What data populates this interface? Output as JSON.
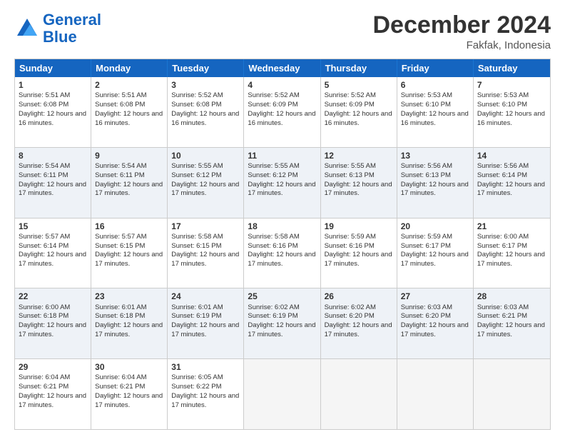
{
  "logo": {
    "line1": "General",
    "line2": "Blue"
  },
  "title": "December 2024",
  "location": "Fakfak, Indonesia",
  "weekdays": [
    "Sunday",
    "Monday",
    "Tuesday",
    "Wednesday",
    "Thursday",
    "Friday",
    "Saturday"
  ],
  "rows": [
    [
      null,
      {
        "day": 2,
        "sunrise": "5:51 AM",
        "sunset": "6:08 PM",
        "daylight": "12 hours and 16 minutes."
      },
      {
        "day": 3,
        "sunrise": "5:52 AM",
        "sunset": "6:08 PM",
        "daylight": "12 hours and 16 minutes."
      },
      {
        "day": 4,
        "sunrise": "5:52 AM",
        "sunset": "6:09 PM",
        "daylight": "12 hours and 16 minutes."
      },
      {
        "day": 5,
        "sunrise": "5:52 AM",
        "sunset": "6:09 PM",
        "daylight": "12 hours and 16 minutes."
      },
      {
        "day": 6,
        "sunrise": "5:53 AM",
        "sunset": "6:10 PM",
        "daylight": "12 hours and 16 minutes."
      },
      {
        "day": 7,
        "sunrise": "5:53 AM",
        "sunset": "6:10 PM",
        "daylight": "12 hours and 16 minutes."
      }
    ],
    [
      {
        "day": 8,
        "sunrise": "5:54 AM",
        "sunset": "6:11 PM",
        "daylight": "12 hours and 17 minutes."
      },
      {
        "day": 9,
        "sunrise": "5:54 AM",
        "sunset": "6:11 PM",
        "daylight": "12 hours and 17 minutes."
      },
      {
        "day": 10,
        "sunrise": "5:55 AM",
        "sunset": "6:12 PM",
        "daylight": "12 hours and 17 minutes."
      },
      {
        "day": 11,
        "sunrise": "5:55 AM",
        "sunset": "6:12 PM",
        "daylight": "12 hours and 17 minutes."
      },
      {
        "day": 12,
        "sunrise": "5:55 AM",
        "sunset": "6:13 PM",
        "daylight": "12 hours and 17 minutes."
      },
      {
        "day": 13,
        "sunrise": "5:56 AM",
        "sunset": "6:13 PM",
        "daylight": "12 hours and 17 minutes."
      },
      {
        "day": 14,
        "sunrise": "5:56 AM",
        "sunset": "6:14 PM",
        "daylight": "12 hours and 17 minutes."
      }
    ],
    [
      {
        "day": 15,
        "sunrise": "5:57 AM",
        "sunset": "6:14 PM",
        "daylight": "12 hours and 17 minutes."
      },
      {
        "day": 16,
        "sunrise": "5:57 AM",
        "sunset": "6:15 PM",
        "daylight": "12 hours and 17 minutes."
      },
      {
        "day": 17,
        "sunrise": "5:58 AM",
        "sunset": "6:15 PM",
        "daylight": "12 hours and 17 minutes."
      },
      {
        "day": 18,
        "sunrise": "5:58 AM",
        "sunset": "6:16 PM",
        "daylight": "12 hours and 17 minutes."
      },
      {
        "day": 19,
        "sunrise": "5:59 AM",
        "sunset": "6:16 PM",
        "daylight": "12 hours and 17 minutes."
      },
      {
        "day": 20,
        "sunrise": "5:59 AM",
        "sunset": "6:17 PM",
        "daylight": "12 hours and 17 minutes."
      },
      {
        "day": 21,
        "sunrise": "6:00 AM",
        "sunset": "6:17 PM",
        "daylight": "12 hours and 17 minutes."
      }
    ],
    [
      {
        "day": 22,
        "sunrise": "6:00 AM",
        "sunset": "6:18 PM",
        "daylight": "12 hours and 17 minutes."
      },
      {
        "day": 23,
        "sunrise": "6:01 AM",
        "sunset": "6:18 PM",
        "daylight": "12 hours and 17 minutes."
      },
      {
        "day": 24,
        "sunrise": "6:01 AM",
        "sunset": "6:19 PM",
        "daylight": "12 hours and 17 minutes."
      },
      {
        "day": 25,
        "sunrise": "6:02 AM",
        "sunset": "6:19 PM",
        "daylight": "12 hours and 17 minutes."
      },
      {
        "day": 26,
        "sunrise": "6:02 AM",
        "sunset": "6:20 PM",
        "daylight": "12 hours and 17 minutes."
      },
      {
        "day": 27,
        "sunrise": "6:03 AM",
        "sunset": "6:20 PM",
        "daylight": "12 hours and 17 minutes."
      },
      {
        "day": 28,
        "sunrise": "6:03 AM",
        "sunset": "6:21 PM",
        "daylight": "12 hours and 17 minutes."
      }
    ],
    [
      {
        "day": 29,
        "sunrise": "6:04 AM",
        "sunset": "6:21 PM",
        "daylight": "12 hours and 17 minutes."
      },
      {
        "day": 30,
        "sunrise": "6:04 AM",
        "sunset": "6:21 PM",
        "daylight": "12 hours and 17 minutes."
      },
      {
        "day": 31,
        "sunrise": "6:05 AM",
        "sunset": "6:22 PM",
        "daylight": "12 hours and 17 minutes."
      },
      null,
      null,
      null,
      null
    ]
  ],
  "row1_day1": {
    "day": 1,
    "sunrise": "5:51 AM",
    "sunset": "6:08 PM",
    "daylight": "12 hours and 16 minutes."
  }
}
